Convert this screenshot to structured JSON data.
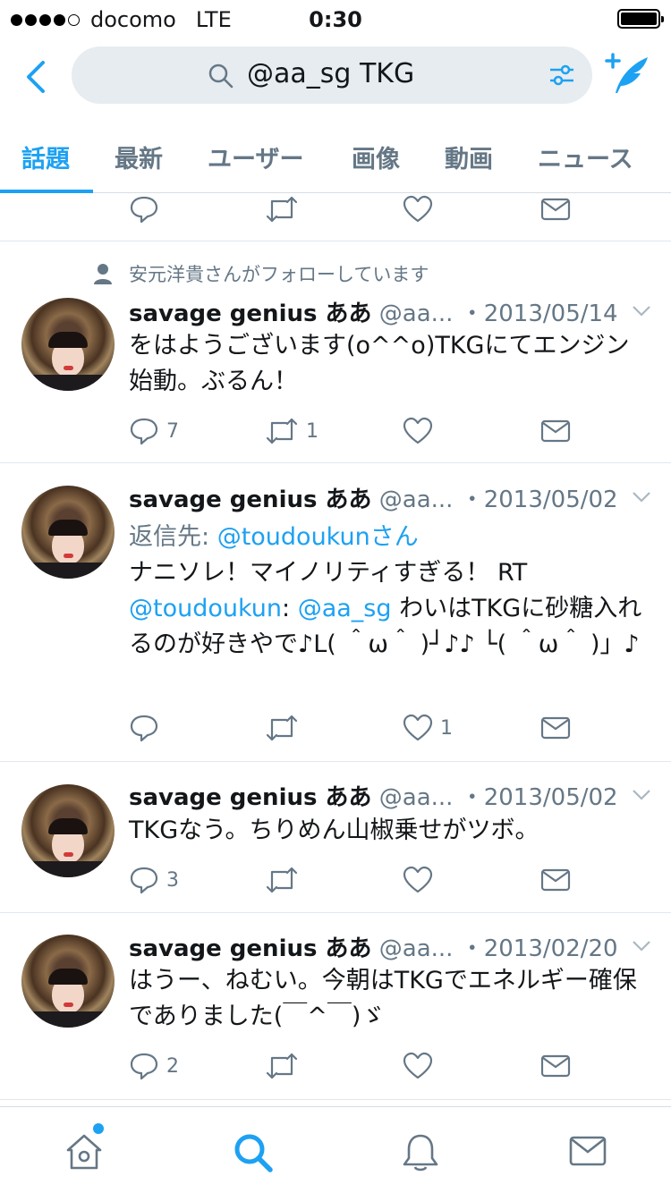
{
  "status_bar": {
    "carrier": "docomo",
    "network": "LTE",
    "time": "0:30"
  },
  "search": {
    "query": "@aa_sg TKG"
  },
  "tabs": [
    {
      "label": "話題"
    },
    {
      "label": "最新"
    },
    {
      "label": "ユーザー"
    },
    {
      "label": "画像"
    },
    {
      "label": "動画"
    },
    {
      "label": "ニュース"
    }
  ],
  "social_context": "安元洋貴さんがフォローしています",
  "tweets": [
    {
      "name": "savage genius ああ",
      "handle": "@aa...",
      "date": "・2013/05/14",
      "text": "をはようございます(o^^o)TKGにてエンジン始動。ぶるん！",
      "reply_count": "7",
      "retweet_count": "1",
      "like_count": ""
    },
    {
      "name": "savage genius ああ",
      "handle": "@aa...",
      "date": "・2013/05/02",
      "reply_label": "返信先: ",
      "reply_target": "@toudoukunさん",
      "text_1": "ナニソレ！マイノリティすぎる！ RT ",
      "mention_1": "@toudoukun",
      "colon": ": ",
      "mention_2": "@aa_sg",
      "text_2": " わいはTKGに砂糖入れるのが好きやで♪L( ＾ω＾ )┘♪♪ └( ＾ω＾ )」♪",
      "reply_count": "",
      "retweet_count": "",
      "like_count": "1"
    },
    {
      "name": "savage genius ああ",
      "handle": "@aa...",
      "date": "・2013/05/02",
      "text": "TKGなう。ちりめん山椒乗せがツボ。",
      "reply_count": "3",
      "retweet_count": "",
      "like_count": ""
    },
    {
      "name": "savage genius ああ",
      "handle": "@aa...",
      "date": "・2013/02/20",
      "text": "はうー、ねむい。今朝はTKGでエネルギー確保でありました(￣^￣)ゞ",
      "reply_count": "2",
      "retweet_count": "",
      "like_count": ""
    }
  ],
  "colors": {
    "accent": "#1da1f2",
    "muted": "#657786",
    "text": "#14171a"
  }
}
